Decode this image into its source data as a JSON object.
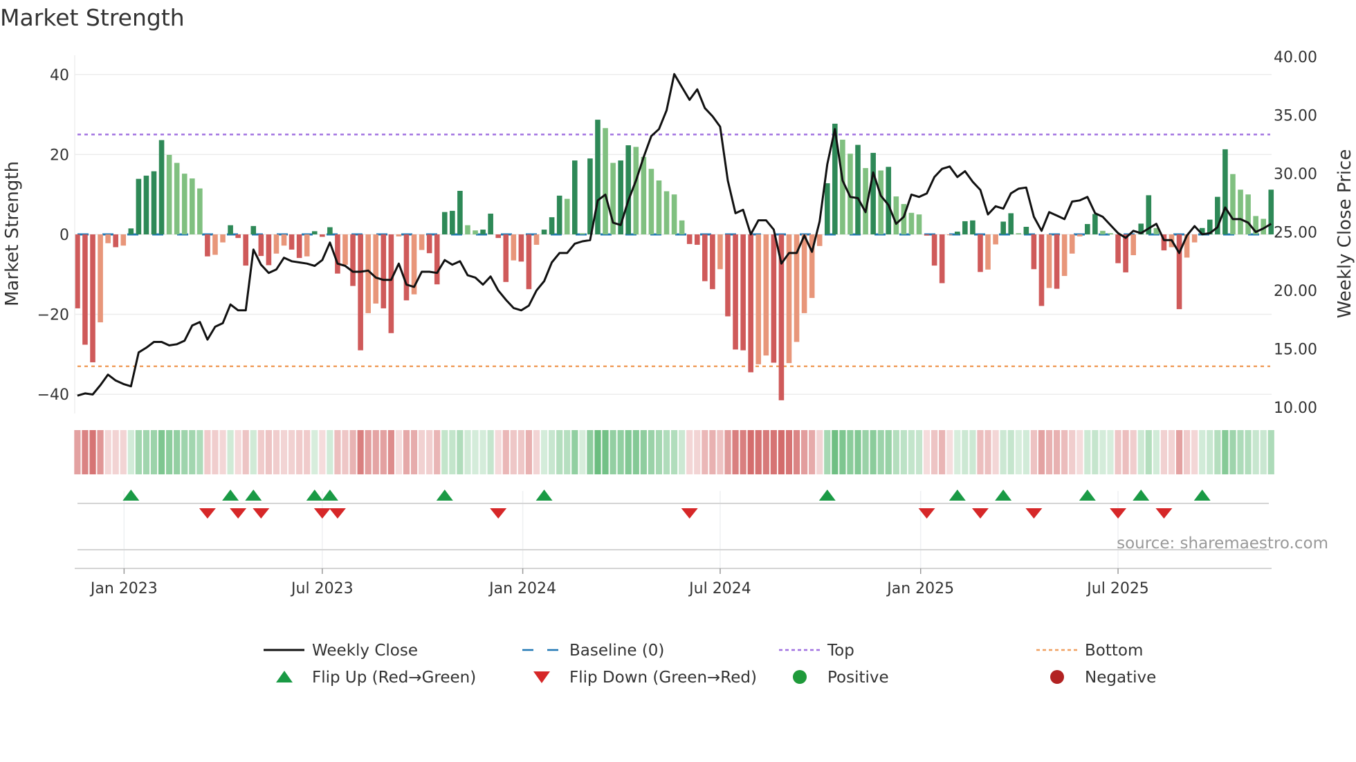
{
  "title": "Market Strength",
  "source": "source: sharemaestro.com",
  "colors": {
    "pos_strong": "#2e8957",
    "pos_weak": "#80c080",
    "neg_strong": "#cf5a5a",
    "neg_weak": "#e8967a",
    "close": "#111111",
    "baseline": "#1f77b4",
    "top": "#a070e0",
    "bottom": "#f0a060",
    "flip_up": "#1a9a45",
    "flip_down": "#d62728",
    "positive": "#1f9a3a",
    "negative": "#b22222"
  },
  "chart_data": {
    "type": "bar+line",
    "title": "Market Strength",
    "ylabel": "Market Strength",
    "y2label": "Weekly Close Price",
    "ylim": [
      -45,
      45
    ],
    "y2lim": [
      8.5,
      41.5
    ],
    "yticks": [
      -40,
      -20,
      0,
      20,
      40
    ],
    "yticklabels": [
      "−40",
      "−20",
      "0",
      "20",
      "40"
    ],
    "y2ticks": [
      10,
      15,
      20,
      25,
      30,
      35,
      40
    ],
    "y2ticklabels": [
      "10.00",
      "15.00",
      "20.00",
      "25.00",
      "30.00",
      "35.00",
      "40.00"
    ],
    "top_level": 25,
    "bottom_level": -33,
    "x_unit": "week index",
    "xticks": [
      {
        "week": 7.1,
        "label": "Jan 2023"
      },
      {
        "week": 33,
        "label": "Jul 2023"
      },
      {
        "week": 59.2,
        "label": "Jan 2024"
      },
      {
        "week": 85,
        "label": "Jul 2024"
      },
      {
        "week": 111.2,
        "label": "Jan 2025"
      },
      {
        "week": 137,
        "label": "Jul 2025"
      }
    ],
    "strength": [
      -18.5,
      -27.6,
      -32,
      -22,
      -2.2,
      -3.2,
      -2.8,
      1.5,
      13.9,
      14.7,
      15.8,
      23.6,
      19.9,
      17.9,
      15.2,
      14,
      11.5,
      -5.5,
      -5.1,
      -2,
      2.3,
      -0.9,
      -7.8,
      2.1,
      -5.4,
      -7.7,
      -4.8,
      -2.8,
      -3.8,
      -5.9,
      -5.5,
      0.8,
      -0.6,
      1.8,
      -9.8,
      -7.6,
      -12.9,
      -29,
      -19.7,
      -17.3,
      -18.5,
      -24.7,
      -0.5,
      -16.5,
      -15,
      -3.9,
      -4.7,
      -12.5,
      5.6,
      5.9,
      10.9,
      2.3,
      1,
      1.2,
      5.2,
      -0.9,
      -11.9,
      -6.5,
      -6.8,
      -13.7,
      -2.6,
      1.2,
      4.3,
      9.7,
      8.9,
      18.5,
      0.3,
      19,
      28.7,
      26.6,
      17.9,
      18.5,
      22.3,
      21.9,
      19.4,
      16.4,
      13.5,
      10.8,
      10,
      3.5,
      -2.4,
      -2.6,
      -11.7,
      -13.7,
      -8.7,
      -20.5,
      -28.8,
      -29,
      -34.5,
      -32.5,
      -30.3,
      -32.1,
      -41.5,
      -32.2,
      -26.9,
      -19.7,
      -15.9,
      -2.9,
      12.8,
      27.7,
      23.7,
      20.2,
      22.4,
      16.6,
      20.4,
      16,
      16.9,
      9.5,
      7.6,
      5.4,
      5,
      -0.3,
      -7.8,
      -12.2,
      -0.2,
      0.7,
      3.3,
      3.5,
      -9.4,
      -8.8,
      -2.5,
      3.2,
      5.3,
      0.3,
      1.9,
      -8.7,
      -17.9,
      -13.4,
      -13.6,
      -10.4,
      -4.8,
      -0.5,
      2.6,
      5.1,
      0.9,
      0.3,
      -7.2,
      -9.5,
      -5.2,
      2.7,
      9.8,
      1.6,
      -4,
      -3.2,
      -18.7,
      -5.8,
      -2,
      1.6,
      3.7,
      9.4,
      21.3,
      15.1,
      11.2,
      10,
      4.6,
      3.9,
      11.2
    ],
    "close": [
      11.0,
      11.2,
      11.1,
      11.9,
      12.8,
      12.3,
      12.0,
      11.8,
      14.7,
      15.1,
      15.6,
      15.6,
      15.3,
      15.4,
      15.7,
      17.0,
      17.3,
      15.8,
      16.9,
      17.2,
      18.8,
      18.3,
      18.3,
      23.5,
      22.2,
      21.5,
      21.8,
      22.8,
      22.5,
      22.4,
      22.3,
      22.1,
      22.6,
      24.1,
      22.3,
      22.1,
      21.6,
      21.6,
      21.7,
      21.1,
      20.9,
      20.9,
      22.3,
      20.5,
      20.3,
      21.6,
      21.6,
      21.5,
      22.6,
      22.2,
      22.5,
      21.3,
      21.1,
      20.5,
      21.2,
      20.0,
      19.2,
      18.5,
      18.3,
      18.7,
      20.0,
      20.8,
      22.4,
      23.2,
      23.2,
      24.0,
      24.2,
      24.3,
      27.7,
      28.2,
      25.8,
      25.6,
      27.7,
      29.4,
      31.4,
      33.2,
      33.8,
      35.4,
      38.5,
      37.4,
      36.3,
      37.2,
      35.6,
      34.9,
      34.0,
      29.4,
      26.6,
      26.9,
      24.8,
      26.0,
      26.0,
      25.2,
      22.3,
      23.2,
      23.2,
      24.7,
      23.3,
      25.9,
      30.8,
      33.8,
      29.4,
      28.0,
      27.9,
      26.7,
      30.1,
      28.1,
      27.3,
      25.7,
      26.3,
      28.2,
      28.0,
      28.3,
      29.7,
      30.4,
      30.6,
      29.7,
      30.2,
      29.3,
      28.6,
      26.5,
      27.2,
      27.0,
      28.3,
      28.7,
      28.8,
      26.3,
      25.1,
      26.7,
      26.4,
      26.1,
      27.6,
      27.7,
      28.0,
      26.6,
      26.3,
      25.6,
      24.9,
      24.5,
      25.1,
      24.9,
      25.3,
      25.7,
      24.3,
      24.3,
      23.2,
      24.7,
      25.5,
      24.8,
      24.9,
      25.4,
      27.1,
      26.1,
      26.1,
      25.8,
      25.0,
      25.3,
      25.7
    ],
    "legend": {
      "placement": "bottom",
      "items": [
        {
          "label": "Weekly Close",
          "symbol": "line"
        },
        {
          "label": "Baseline (0)",
          "symbol": "dash"
        },
        {
          "label": "Top",
          "symbol": "dot-purple"
        },
        {
          "label": "Bottom",
          "symbol": "dot-orange"
        },
        {
          "label": "Flip Up (Red→Green)",
          "symbol": "tri-up"
        },
        {
          "label": "Flip Down (Green→Red)",
          "symbol": "tri-down"
        },
        {
          "label": "Positive",
          "symbol": "circle-green"
        },
        {
          "label": "Negative",
          "symbol": "circle-red"
        }
      ]
    }
  }
}
